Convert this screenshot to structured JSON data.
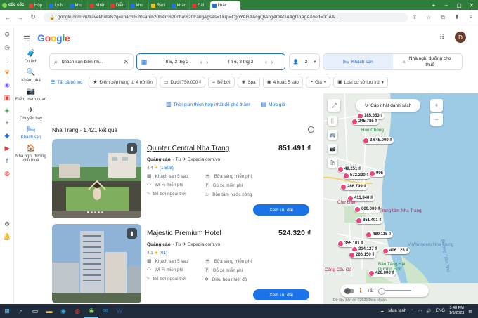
{
  "browser": {
    "brand": "cốc cốc",
    "tabs": [
      {
        "label": "Hộp",
        "color": "#ea4335"
      },
      {
        "label": "Ly N",
        "color": "#1a73e8"
      },
      {
        "label": "khu",
        "color": "#1a73e8"
      },
      {
        "label": "Khán",
        "color": "#e53935"
      },
      {
        "label": "Diễn",
        "color": "#e53935"
      },
      {
        "label": "khu",
        "color": "#1a73e8"
      },
      {
        "label": "Radi",
        "color": "#fbbc04"
      },
      {
        "label": "khác",
        "color": "#1a73e8"
      },
      {
        "label": "Đất",
        "color": "#e53935"
      },
      {
        "label": "khác",
        "color": "#1a73e8",
        "active": true
      }
    ],
    "url": "google.com.vn/travel/hotels?q=khách%20sạn%20biển%20nha%20trang&gsas=1&rp=CgpYAGAAcgQIAhgAOAGAAgGoAgA&ved=0CAA..."
  },
  "google": {
    "logo": "Google",
    "avatar_letter": "D"
  },
  "leftnav": [
    {
      "label": "Du lịch",
      "icon": "🧳"
    },
    {
      "label": "Khám phá",
      "icon": "🔍"
    },
    {
      "label": "Điểm tham quan",
      "icon": "📷"
    },
    {
      "label": "Chuyến bay",
      "icon": "✈"
    },
    {
      "label": "Khách sạn",
      "icon": "🛏",
      "selected": true
    },
    {
      "label": "Nhà nghỉ dưỡng cho thuê",
      "icon": "🏠"
    }
  ],
  "search": {
    "value": "khách sạn biển nh...",
    "checkin": "Th 5, 2 thg 2",
    "checkout": "Th 6, 3 thg 2",
    "guests": "2",
    "type_hotels": "Khách sạn",
    "type_rentals": "Nhà nghỉ dưỡng cho thuê"
  },
  "filters": [
    {
      "label": "Tất cả bộ lọc",
      "icon": "☰",
      "link": true
    },
    {
      "label": "Điểm xếp hạng từ 4 trở lên",
      "icon": "★"
    },
    {
      "label": "Dưới 750.000 ₫",
      "icon": "▭"
    },
    {
      "label": "Bể bơi",
      "icon": "≈"
    },
    {
      "label": "Spa",
      "icon": "❀"
    },
    {
      "label": "4 hoặc 5 sao",
      "icon": "◉"
    },
    {
      "label": "Giá",
      "icon": "◔",
      "dropdown": true
    },
    {
      "label": "Loại cơ sở lưu trú",
      "icon": "▣",
      "dropdown": true
    }
  ],
  "links": {
    "best_time": "Thời gian thích hợp nhất để ghé thăm",
    "prices": "Mức giá"
  },
  "results_count": "Nha Trang · 1.421 kết quả",
  "hotels": [
    {
      "name": "Quinter Central Nha Trang",
      "price": "851.491 ₫",
      "ad": "Quảng cáo",
      "source": "· Từ",
      "site": "Expedia.com.vn",
      "rating": "4,4",
      "reviews": "(1.508)",
      "amenities": [
        "Khách sạn 5 sao",
        "Bữa sáng miễn phí",
        "Wi-Fi miễn phí",
        "Đỗ xe miễn phí",
        "Bể bơi ngoài trời",
        "Bồn tắm nước nóng"
      ],
      "button": "Xem ưu đãi"
    },
    {
      "name": "Majestic Premium Hotel",
      "price": "524.320 ₫",
      "ad": "Quảng cáo",
      "source": "· Từ",
      "site": "Expedia.com.vn",
      "rating": "4,1",
      "reviews": "(91)",
      "amenities": [
        "Khách sạn 5 sao",
        "Bữa sáng miễn phí",
        "Wi-Fi miễn phí",
        "Đỗ xe miễn phí",
        "Bể bơi ngoài trời",
        "Điều hòa nhiệt độ"
      ],
      "button": "Xem ưu đãi"
    }
  ],
  "map": {
    "update_label": "Cập nhật danh sách",
    "pins": [
      "185.653 ₫",
      "245.785 ₫",
      "3.645.000 ₫",
      "49.251 ₫",
      "572.220 ₫",
      "905",
      "266.799 ₫",
      "411.840 ₫",
      "600.000 ₫",
      "851.491 ₫",
      "489.115 ₫",
      "355.101 ₫",
      "314.127 ₫",
      "406.125 ₫",
      "266.150 ₫",
      "420.000 ₫"
    ],
    "labels": [
      "Hòn Chồng",
      "Chợ Đầm",
      "Trung tâm Nha Trang",
      "VinWonders Nha Trang",
      "Bảo Tàng Hải Dương Học",
      "Đường Trần Phú",
      "Cảng Cầu Đá"
    ],
    "toggle_label": "Tắt",
    "attribution": "Dữ liệu bản đồ ©2023   Điều khoản"
  },
  "taskbar": {
    "weather": "Mưa tạnh",
    "lang": "ENG",
    "time": "3:48 PM",
    "date": "1/6/2023"
  }
}
